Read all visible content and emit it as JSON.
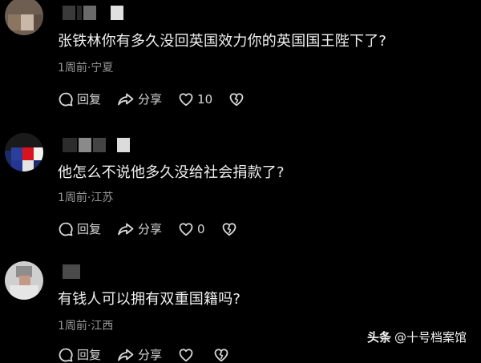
{
  "comments": [
    {
      "text": "张铁林你有多久没回英国效力你的英国国王陛下了?",
      "meta": "1周前·宁夏",
      "reply_label": "回复",
      "share_label": "分享",
      "like_count": "10"
    },
    {
      "text": "他怎么不说他多久没给社会捐款了?",
      "meta": "1周前·江苏",
      "reply_label": "回复",
      "share_label": "分享",
      "like_count": "0"
    },
    {
      "text": "有钱人可以拥有双重国籍吗?",
      "meta": "1周前·江西",
      "reply_label": "回复",
      "share_label": "分享",
      "like_count": ""
    }
  ],
  "watermark": {
    "brand": "头条",
    "account": "@十号档案馆"
  },
  "icons": [
    "comment-icon",
    "share-icon",
    "heart-icon",
    "dislike-icon"
  ]
}
